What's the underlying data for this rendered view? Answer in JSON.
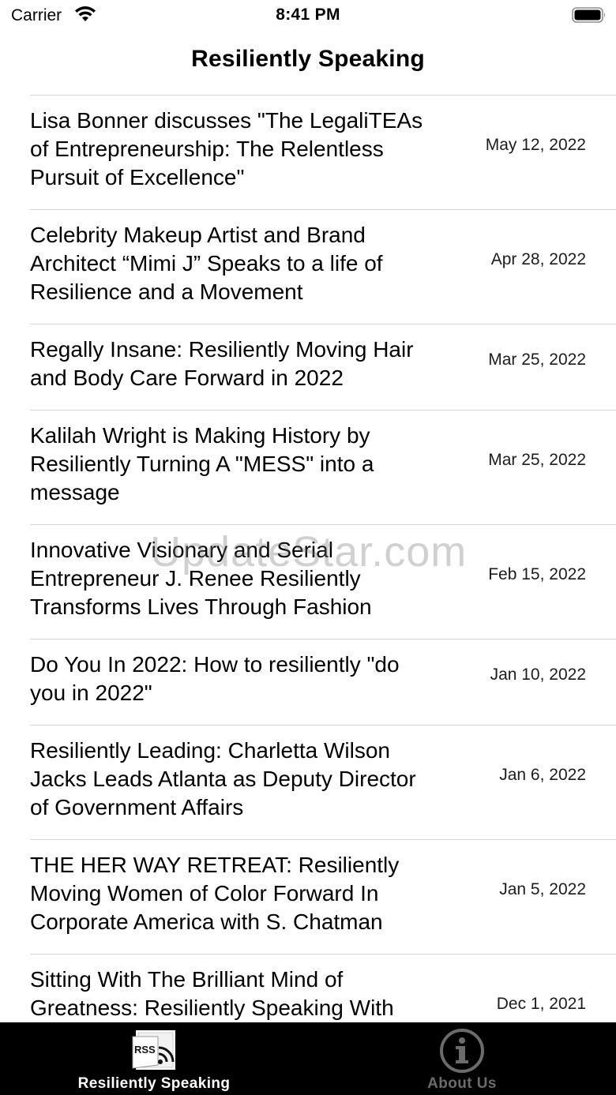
{
  "status_bar": {
    "carrier": "Carrier",
    "time": "8:41 PM"
  },
  "nav": {
    "title": "Resiliently Speaking"
  },
  "articles": [
    {
      "title_lines": [
        "Lisa Bonner discusses \"The LegaliTEAs",
        "of Entrepreneurship: The Relentless",
        "Pursuit of Excellence\""
      ],
      "date": "May 12, 2022"
    },
    {
      "title_lines": [
        "Celebrity Makeup Artist and Brand",
        "Architect “Mimi J” Speaks to a life of",
        "Resilience and a Movement"
      ],
      "date": "Apr 28, 2022"
    },
    {
      "title_lines": [
        "Regally Insane: Resiliently Moving Hair",
        "and Body Care Forward in 2022"
      ],
      "date": "Mar 25, 2022"
    },
    {
      "title_lines": [
        "Kalilah Wright is Making History by",
        "Resiliently Turning A \"MESS\" into a",
        "message"
      ],
      "date": "Mar 25, 2022"
    },
    {
      "title_lines": [
        "Innovative Visionary and Serial",
        "Entrepreneur J. Renee Resiliently",
        "Transforms Lives Through Fashion"
      ],
      "date": "Feb 15, 2022"
    },
    {
      "title_lines": [
        "Do You In 2022: How to resiliently \"do",
        "you in 2022\""
      ],
      "date": "Jan 10, 2022"
    },
    {
      "title_lines": [
        "Resiliently Leading: Charletta Wilson",
        "Jacks Leads Atlanta as Deputy Director",
        "of Government Affairs"
      ],
      "date": "Jan 6, 2022"
    },
    {
      "title_lines": [
        "THE HER WAY RETREAT: Resiliently",
        "Moving Women of Color Forward In",
        "Corporate America with S. Chatman"
      ],
      "date": "Jan 5, 2022"
    },
    {
      "title_lines": [
        "Sitting With The Brilliant Mind of",
        "Greatness: Resiliently Speaking With",
        ""
      ],
      "date": "Dec 1, 2021"
    }
  ],
  "watermark": "UpdateStar.com",
  "tab_bar": {
    "tabs": [
      {
        "label": "Resiliently Speaking",
        "icon": "rss-icon",
        "icon_text": "RSS",
        "selected": true
      },
      {
        "label": "About Us",
        "icon": "info-icon",
        "selected": false
      }
    ]
  },
  "colors": {
    "divider": "#d7d7d9",
    "tab_bar_bg": "#000000",
    "tab_selected": "#ffffff",
    "tab_unselected": "#6b6b6b"
  }
}
